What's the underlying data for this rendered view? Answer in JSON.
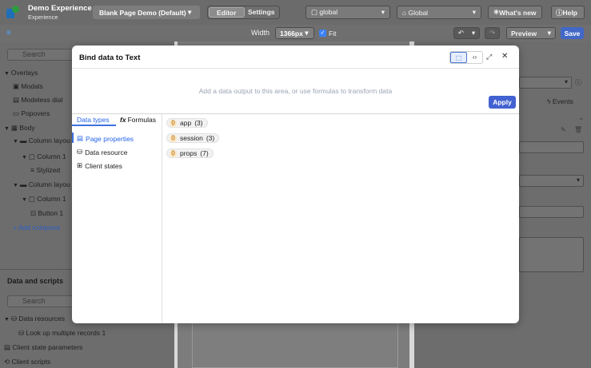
{
  "app": {
    "title": "Demo Experience",
    "subtitle": "Experience",
    "page_selector": "Blank Page Demo (Default)",
    "mode_tabs": [
      "Editor",
      "Settings"
    ],
    "scope_select": "global",
    "scope_select_2": "Global",
    "whats_new": "What's new",
    "help": "Help"
  },
  "toolbar": {
    "width_label": "Width",
    "width_value": "1366px",
    "fit_label": "Fit",
    "preview_label": "Preview",
    "save_label": "Save"
  },
  "left_panel": {
    "search_placeholder": "Search",
    "tree": [
      {
        "label": "Overlays",
        "depth": 0,
        "icon": "overlay-icon",
        "caret": "▼"
      },
      {
        "label": "Modals",
        "depth": 1,
        "icon": "modal-icon",
        "caret": ""
      },
      {
        "label": "Modeless dial",
        "depth": 1,
        "icon": "modeless-icon",
        "caret": ""
      },
      {
        "label": "Popovers",
        "depth": 1,
        "icon": "popover-icon",
        "caret": ""
      },
      {
        "label": "Body",
        "depth": 0,
        "icon": "body-icon",
        "caret": "▼"
      },
      {
        "label": "Column layou",
        "depth": 1,
        "icon": "column-layout-icon",
        "caret": "▼"
      },
      {
        "label": "Column 1",
        "depth": 2,
        "icon": "column-icon",
        "caret": "▼"
      },
      {
        "label": "Stylized",
        "depth": 3,
        "icon": "text-icon",
        "caret": ""
      },
      {
        "label": "Column layou",
        "depth": 1,
        "icon": "column-layout-icon",
        "caret": "▼"
      },
      {
        "label": "Column 1",
        "depth": 2,
        "icon": "column-icon",
        "caret": "▼"
      },
      {
        "label": "Button 1",
        "depth": 3,
        "icon": "button-icon",
        "caret": ""
      },
      {
        "label": "Add compone",
        "depth": 1,
        "icon": "add-icon",
        "caret": ""
      }
    ],
    "data_section_title": "Data and scripts",
    "data_search_placeholder": "Search",
    "data_tree": [
      {
        "label": "Data resources",
        "depth": 0,
        "caret": "▼"
      },
      {
        "label": "Look up multiple records 1",
        "depth": 1,
        "caret": ""
      },
      {
        "label": "Client state parameters",
        "depth": 0,
        "caret": ""
      },
      {
        "label": "Client scripts",
        "depth": 0,
        "caret": ""
      }
    ]
  },
  "right_panel": {
    "events_tab": "Events"
  },
  "modal": {
    "title": "Bind data to Text",
    "drop_hint": "Add a data output to this area, or use formulas to transform data",
    "apply_label": "Apply",
    "tabs": [
      "Data types",
      "Formulas"
    ],
    "nav_items": [
      {
        "label": "Page properties",
        "icon": "page-icon"
      },
      {
        "label": "Data resource",
        "icon": "database-icon"
      },
      {
        "label": "Client states",
        "icon": "client-state-icon"
      }
    ],
    "chips": [
      {
        "name": "app",
        "count": "(3)"
      },
      {
        "name": "session",
        "count": "(3)"
      },
      {
        "name": "props",
        "count": "(7)"
      }
    ]
  }
}
